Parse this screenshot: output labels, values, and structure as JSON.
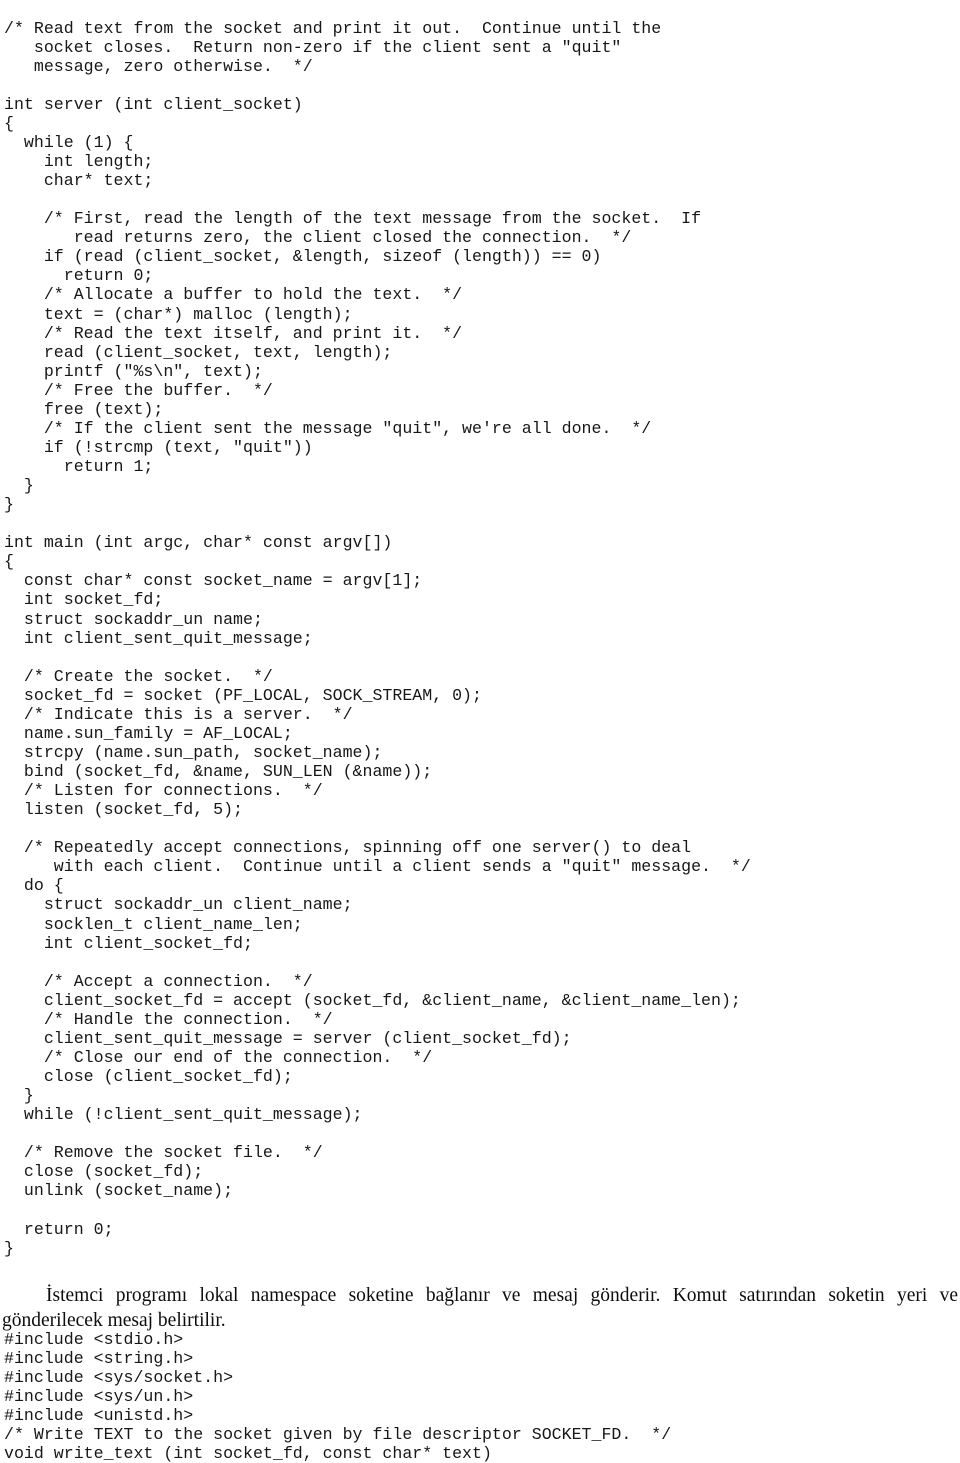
{
  "document": {
    "background_color": "#ffffff",
    "text_color": "#171717",
    "code_top": {
      "language": "c",
      "lines": [
        "/* Read text from the socket and print it out.  Continue until the",
        "   socket closes.  Return non-zero if the client sent a \"quit\"",
        "   message, zero otherwise.  */",
        "",
        "int server (int client_socket)",
        "{",
        "  while (1) {",
        "    int length;",
        "    char* text;",
        "",
        "    /* First, read the length of the text message from the socket.  If",
        "       read returns zero, the client closed the connection.  */",
        "    if (read (client_socket, &length, sizeof (length)) == 0)",
        "      return 0;",
        "    /* Allocate a buffer to hold the text.  */",
        "    text = (char*) malloc (length);",
        "    /* Read the text itself, and print it.  */",
        "    read (client_socket, text, length);",
        "    printf (\"%s\\n\", text);",
        "    /* Free the buffer.  */",
        "    free (text);",
        "    /* If the client sent the message \"quit\", we're all done.  */",
        "    if (!strcmp (text, \"quit\"))",
        "      return 1;",
        "  }",
        "}",
        "",
        "int main (int argc, char* const argv[])",
        "{",
        "  const char* const socket_name = argv[1];",
        "  int socket_fd;",
        "  struct sockaddr_un name;",
        "  int client_sent_quit_message;",
        "",
        "  /* Create the socket.  */",
        "  socket_fd = socket (PF_LOCAL, SOCK_STREAM, 0);",
        "  /* Indicate this is a server.  */",
        "  name.sun_family = AF_LOCAL;",
        "  strcpy (name.sun_path, socket_name);",
        "  bind (socket_fd, &name, SUN_LEN (&name));",
        "  /* Listen for connections.  */",
        "  listen (socket_fd, 5);",
        "",
        "  /* Repeatedly accept connections, spinning off one server() to deal",
        "     with each client.  Continue until a client sends a \"quit\" message.  */",
        "  do {",
        "    struct sockaddr_un client_name;",
        "    socklen_t client_name_len;",
        "    int client_socket_fd;",
        "",
        "    /* Accept a connection.  */",
        "    client_socket_fd = accept (socket_fd, &client_name, &client_name_len);",
        "    /* Handle the connection.  */",
        "    client_sent_quit_message = server (client_socket_fd);",
        "    /* Close our end of the connection.  */",
        "    close (client_socket_fd);",
        "  }",
        "  while (!client_sent_quit_message);",
        "",
        "  /* Remove the socket file.  */",
        "  close (socket_fd);",
        "  unlink (socket_name);",
        "",
        "  return 0;",
        "}"
      ]
    },
    "paragraph": {
      "language": "tr",
      "text": "İstemci programı lokal namespace soketine bağlanır ve mesaj gönderir. Komut satırından soketin yeri ve gönderilecek mesaj belirtilir."
    },
    "code_bottom": {
      "language": "c",
      "lines": [
        "#include <stdio.h>",
        "#include <string.h>",
        "#include <sys/socket.h>",
        "#include <sys/un.h>",
        "#include <unistd.h>",
        "/* Write TEXT to the socket given by file descriptor SOCKET_FD.  */",
        "void write_text (int socket_fd, const char* text)"
      ]
    }
  }
}
